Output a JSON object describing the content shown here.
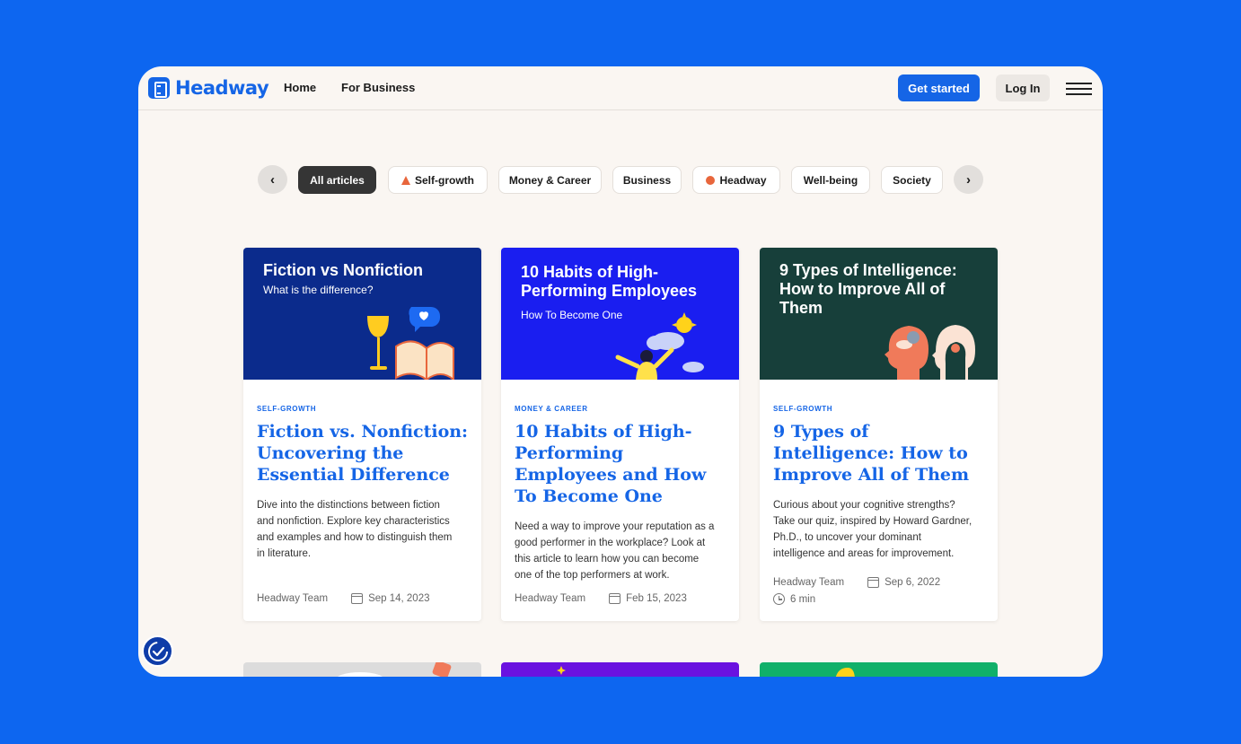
{
  "header": {
    "logo_text": "Headway",
    "nav": [
      {
        "label": "Home"
      },
      {
        "label": "For Business"
      }
    ],
    "get_started_label": "Get started",
    "login_label": "Log In"
  },
  "filters": {
    "chips": [
      {
        "label": "All articles",
        "active": true,
        "icon": null
      },
      {
        "label": "Self-growth",
        "active": false,
        "icon": "mountain-icon"
      },
      {
        "label": "Money & Career",
        "active": false,
        "icon": null
      },
      {
        "label": "Business",
        "active": false,
        "icon": null
      },
      {
        "label": "Headway",
        "active": false,
        "icon": "headway-dot-icon"
      },
      {
        "label": "Well-being",
        "active": false,
        "icon": null
      },
      {
        "label": "Society",
        "active": false,
        "icon": null
      }
    ]
  },
  "articles": [
    {
      "hero_title": "Fiction vs Nonfiction",
      "hero_subtitle": "What is the difference?",
      "hero_color": "#0b2b8c",
      "tag": "SELF-GROWTH",
      "title": "Fiction vs. Nonfiction: Uncovering the Essential Difference",
      "description": "Dive into the distinctions between fiction and nonfiction. Explore key characteristics and examples and how to distinguish them in literature.",
      "author": "Headway Team",
      "date": "Sep 14, 2023",
      "read_time": null
    },
    {
      "hero_title": "10 Habits of High-Performing Employees",
      "hero_subtitle": "How To Become One",
      "hero_color": "#1a1ef0",
      "tag": "MONEY & CAREER",
      "title": "10 Habits of High-Performing Employees and How To Become One",
      "description": "Need a way to improve your reputation as a good performer in the workplace? Look at this article to learn how you can become one of the top performers at work.",
      "author": "Headway Team",
      "date": "Feb 15, 2023",
      "read_time": null
    },
    {
      "hero_title": "9 Types of Intelligence: How to Improve All of Them",
      "hero_subtitle": "",
      "hero_color": "#173f3a",
      "tag": "SELF-GROWTH",
      "title": "9 Types of Intelligence: How to Improve All of Them",
      "description": "Curious about your cognitive strengths? Take our quiz, inspired by Howard Gardner, Ph.D., to uncover your dominant intelligence and areas for improvement.",
      "author": "Headway Team",
      "date": "Sep 6, 2022",
      "read_time": "6 min"
    }
  ],
  "colors": {
    "page_background": "#0d66f0",
    "accent": "#1565e6",
    "surface": "#faf6f2"
  }
}
